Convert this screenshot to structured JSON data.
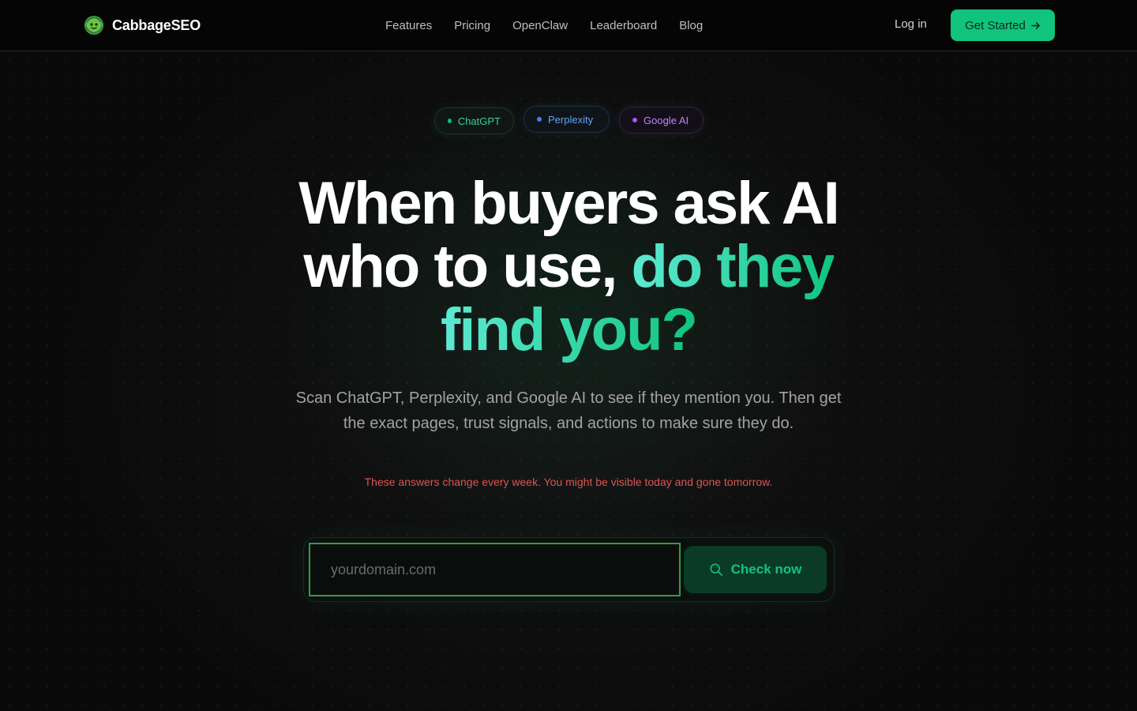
{
  "header": {
    "brand_name": "CabbageSEO",
    "nav": [
      {
        "label": "Features"
      },
      {
        "label": "Pricing"
      },
      {
        "label": "OpenClaw"
      },
      {
        "label": "Leaderboard"
      },
      {
        "label": "Blog"
      }
    ],
    "login_label": "Log in",
    "cta_label": "Get Started"
  },
  "pills": {
    "chatgpt": "ChatGPT",
    "perplexity": "Perplexity",
    "google": "Google AI"
  },
  "hero": {
    "headline_line1": "When buyers ask AI",
    "headline_line2": "who to use,",
    "headline_accent_1": "do they",
    "headline_accent_2": "find you?",
    "subtext": "Scan ChatGPT, Perplexity, and Google AI to see if they mention you. Then get the exact pages, trust signals, and actions to make sure they do.",
    "warning": "These answers change every week. You might be visible today and gone tomorrow."
  },
  "search": {
    "placeholder": "yourdomain.com",
    "value": "",
    "button_label": "Check now"
  },
  "colors": {
    "accent": "#10c47e",
    "warning": "#e05252",
    "chatgpt_dot": "#10b981",
    "perplexity_dot": "#3b82f6",
    "google_dot": "#a855f7"
  },
  "icons": {
    "brand": "cabbage-logo-icon",
    "cta": "arrow-right-icon",
    "search": "search-icon"
  }
}
